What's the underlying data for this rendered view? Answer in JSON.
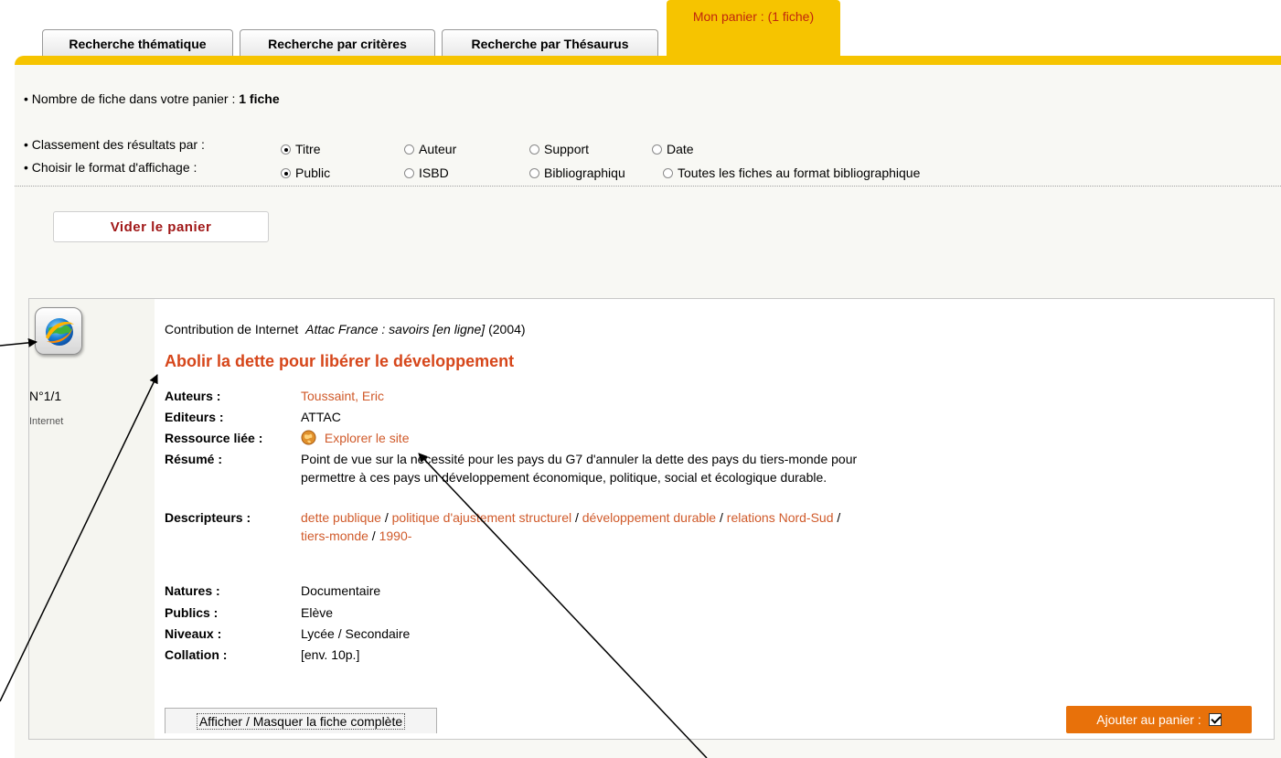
{
  "tabs": [
    {
      "label": "Recherche thématique"
    },
    {
      "label": "Recherche par critères"
    },
    {
      "label": "Recherche par Thésaurus"
    }
  ],
  "active_tab": {
    "label": "Mon panier :",
    "count": "(1 fiche)"
  },
  "basket": {
    "count_label": "• Nombre de fiche dans votre panier :",
    "count_value": "1 fiche",
    "sort_label": "• Classement des résultats par :",
    "sort_options": [
      "Titre",
      "Auteur",
      "Support",
      "Date"
    ],
    "format_label": "• Choisir le format d'affichage :",
    "format_options": [
      "Public",
      "ISBD",
      "Bibliographiqu",
      "Toutes les fiches au format bibliographique"
    ],
    "empty_button": "Vider le panier"
  },
  "record": {
    "number": "N°1/1",
    "type": "Internet",
    "contribution_prefix": "Contribution de Internet",
    "contribution_source": "Attac France : savoirs [en ligne]",
    "contribution_year": "(2004)",
    "title": "Abolir la dette pour libérer le développement",
    "fields": {
      "auteurs_label": "Auteurs :",
      "auteurs_value": "Toussaint, Eric",
      "editeurs_label": "Editeurs :",
      "editeurs_value": "ATTAC",
      "ressource_label": "Ressource liée :",
      "ressource_value": "Explorer le site",
      "resume_label": "Résumé :",
      "resume_line1": "Point de vue sur la nécessité pour les pays du G7 d'annuler la dette des pays du tiers-monde pour",
      "resume_line2": "permettre à ces pays un développement économique, politique, social et écologique durable.",
      "descripteurs_label": "Descripteurs :",
      "descripteurs": [
        "dette publique",
        "politique d'ajustement structurel",
        "développement durable",
        "relations Nord-Sud",
        "tiers-monde",
        "1990-"
      ],
      "natures_label": "Natures :",
      "natures_value": "Documentaire",
      "publics_label": "Publics :",
      "publics_value": "Elève",
      "niveaux_label": "Niveaux :",
      "niveaux_value": "Lycée / Secondaire",
      "collation_label": "Collation :",
      "collation_value": "[env. 10p.]"
    },
    "toggle_button": "Afficher / Masquer la fiche complète",
    "add_button": "Ajouter au panier :"
  },
  "icons": {
    "record_icon": "globe-icon",
    "resource_icon": "globe-small-icon",
    "checkbox": "checkbox-checked-icon"
  },
  "colors": {
    "tab_accent": "#f6c400",
    "link": "#d05a2a",
    "title": "#d6461a",
    "add_button": "#e8710a"
  }
}
